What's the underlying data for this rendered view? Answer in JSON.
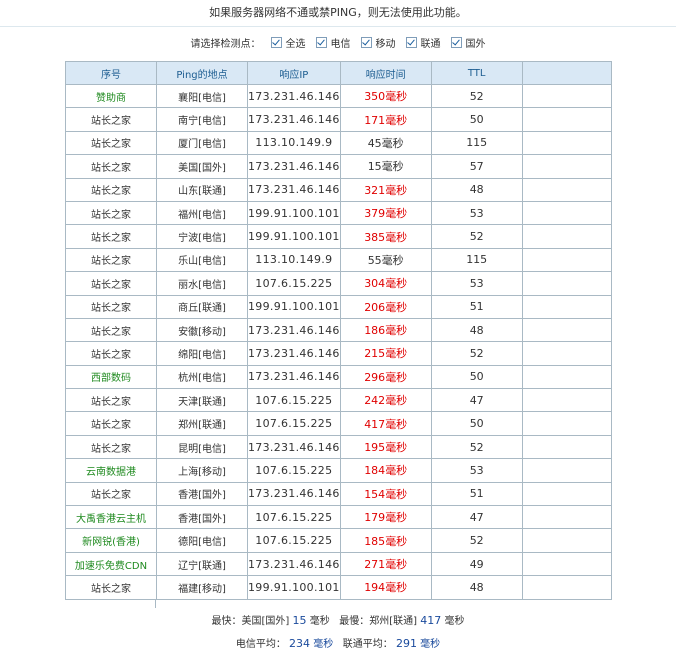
{
  "notice": "如果服务器网络不通或禁PING，则无法使用此功能。",
  "checks": {
    "prompt": "请选择检测点：",
    "options": [
      "全选",
      "电信",
      "移动",
      "联通",
      "国外"
    ]
  },
  "table": {
    "headers": [
      "序号",
      "Ping的地点",
      "响应IP",
      "响应时间",
      "TTL",
      ""
    ],
    "rows": [
      {
        "node": "赞助商",
        "loc": "襄阳[电信]",
        "ip": "173.231.46.146",
        "time": "350",
        "ttl": "52",
        "green": true,
        "red": true
      },
      {
        "node": "站长之家",
        "loc": "南宁[电信]",
        "ip": "173.231.46.146",
        "time": "171",
        "ttl": "50",
        "green": false,
        "red": true
      },
      {
        "node": "站长之家",
        "loc": "厦门[电信]",
        "ip": "113.10.149.9",
        "time": "45",
        "ttl": "115",
        "green": false,
        "red": false
      },
      {
        "node": "站长之家",
        "loc": "美国[国外]",
        "ip": "173.231.46.146",
        "time": "15",
        "ttl": "57",
        "green": false,
        "red": false
      },
      {
        "node": "站长之家",
        "loc": "山东[联通]",
        "ip": "173.231.46.146",
        "time": "321",
        "ttl": "48",
        "green": false,
        "red": true
      },
      {
        "node": "站长之家",
        "loc": "福州[电信]",
        "ip": "199.91.100.101",
        "time": "379",
        "ttl": "53",
        "green": false,
        "red": true
      },
      {
        "node": "站长之家",
        "loc": "宁波[电信]",
        "ip": "199.91.100.101",
        "time": "385",
        "ttl": "52",
        "green": false,
        "red": true
      },
      {
        "node": "站长之家",
        "loc": "乐山[电信]",
        "ip": "113.10.149.9",
        "time": "55",
        "ttl": "115",
        "green": false,
        "red": false
      },
      {
        "node": "站长之家",
        "loc": "丽水[电信]",
        "ip": "107.6.15.225",
        "time": "304",
        "ttl": "53",
        "green": false,
        "red": true
      },
      {
        "node": "站长之家",
        "loc": "商丘[联通]",
        "ip": "199.91.100.101",
        "time": "206",
        "ttl": "51",
        "green": false,
        "red": true
      },
      {
        "node": "站长之家",
        "loc": "安徽[移动]",
        "ip": "173.231.46.146",
        "time": "186",
        "ttl": "48",
        "green": false,
        "red": true
      },
      {
        "node": "站长之家",
        "loc": "绵阳[电信]",
        "ip": "173.231.46.146",
        "time": "215",
        "ttl": "52",
        "green": false,
        "red": true
      },
      {
        "node": "西部数码",
        "loc": "杭州[电信]",
        "ip": "173.231.46.146",
        "time": "296",
        "ttl": "50",
        "green": true,
        "red": true
      },
      {
        "node": "站长之家",
        "loc": "天津[联通]",
        "ip": "107.6.15.225",
        "time": "242",
        "ttl": "47",
        "green": false,
        "red": true
      },
      {
        "node": "站长之家",
        "loc": "郑州[联通]",
        "ip": "107.6.15.225",
        "time": "417",
        "ttl": "50",
        "green": false,
        "red": true
      },
      {
        "node": "站长之家",
        "loc": "昆明[电信]",
        "ip": "173.231.46.146",
        "time": "195",
        "ttl": "52",
        "green": false,
        "red": true
      },
      {
        "node": "云南数据港",
        "loc": "上海[移动]",
        "ip": "107.6.15.225",
        "time": "184",
        "ttl": "53",
        "green": true,
        "red": true
      },
      {
        "node": "站长之家",
        "loc": "香港[国外]",
        "ip": "173.231.46.146",
        "time": "154",
        "ttl": "51",
        "green": false,
        "red": true
      },
      {
        "node": "大禹香港云主机",
        "loc": "香港[国外]",
        "ip": "107.6.15.225",
        "time": "179",
        "ttl": "47",
        "green": true,
        "red": true
      },
      {
        "node": "新网锐(香港)",
        "loc": "德阳[电信]",
        "ip": "107.6.15.225",
        "time": "185",
        "ttl": "52",
        "green": true,
        "red": true
      },
      {
        "node": "加速乐免费CDN",
        "loc": "辽宁[联通]",
        "ip": "173.231.46.146",
        "time": "271",
        "ttl": "49",
        "green": true,
        "red": true
      },
      {
        "node": "站长之家",
        "loc": "福建[移动]",
        "ip": "199.91.100.101",
        "time": "194",
        "ttl": "48",
        "green": false,
        "red": true
      }
    ]
  },
  "unit": "毫秒",
  "summary": {
    "fastest_label": "最快：",
    "fastest_loc": "美国[国外]",
    "fastest_val": "15",
    "slowest_label": "最慢：",
    "slowest_loc": "郑州[联通]",
    "slowest_val": "417",
    "telecom_label": "电信平均：",
    "telecom_val": "234",
    "unicom_label": "联通平均：",
    "unicom_val": "291"
  }
}
